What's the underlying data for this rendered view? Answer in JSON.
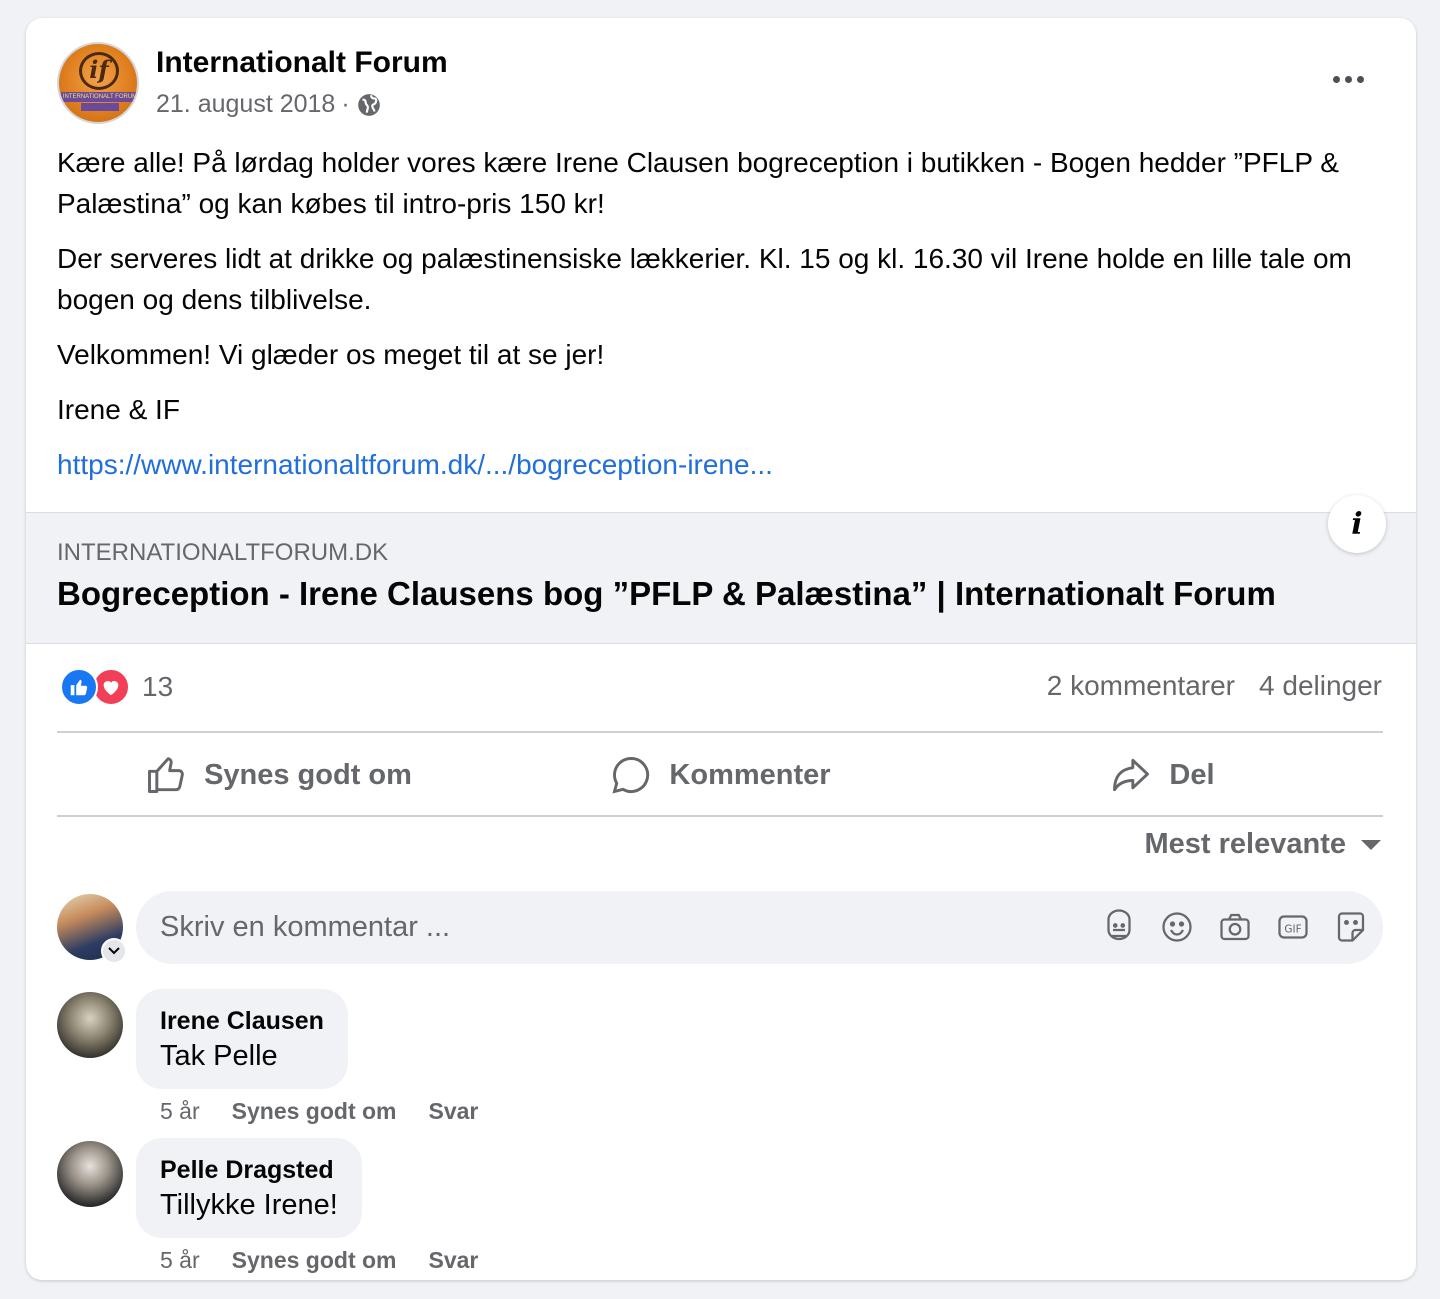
{
  "post": {
    "page_name": "Internationalt Forum",
    "date": "21. august 2018",
    "separator": "·",
    "avatar_logo_text": "if",
    "avatar_band_text": "INTERNATIONALT FORUM",
    "paragraphs": [
      "Kære alle! På lørdag holder vores kære Irene Clausen bogreception i butikken - Bogen hedder ”PFLP & Palæstina” og kan købes til intro-pris 150 kr!",
      "Der serveres lidt at drikke og palæstinensiske lækkerier. Kl. 15 og kl. 16.30 vil Irene holde en lille tale om bogen og dens tilblivelse.",
      "Velkommen! Vi glæder os meget til at se jer!",
      "Irene & IF"
    ],
    "link_text": "https://www.internationaltforum.dk/.../bogreception-irene..."
  },
  "preview": {
    "domain": "INTERNATIONALTFORUM.DK",
    "title": "Bogreception - Irene Clausens bog ”PFLP & Palæstina” | Internationalt Forum",
    "info_glyph": "i"
  },
  "stats": {
    "reaction_count": "13",
    "comments": "2 kommentarer",
    "shares": "4 delinger"
  },
  "actions": {
    "like": "Synes godt om",
    "comment": "Kommenter",
    "share": "Del"
  },
  "sort": {
    "label": "Mest relevante"
  },
  "composer": {
    "placeholder": "Skriv en kommentar ..."
  },
  "comments": [
    {
      "author": "Irene Clausen",
      "text": "Tak Pelle",
      "age": "5 år",
      "like": "Synes godt om",
      "reply": "Svar"
    },
    {
      "author": "Pelle Dragsted",
      "text": "Tillykke Irene!",
      "age": "5 år",
      "like": "Synes godt om",
      "reply": "Svar"
    }
  ],
  "colors": {
    "accent_blue": "#1877f2",
    "link_blue": "#216fdb",
    "love_red": "#f33e58",
    "secondary_text": "#65676b"
  }
}
